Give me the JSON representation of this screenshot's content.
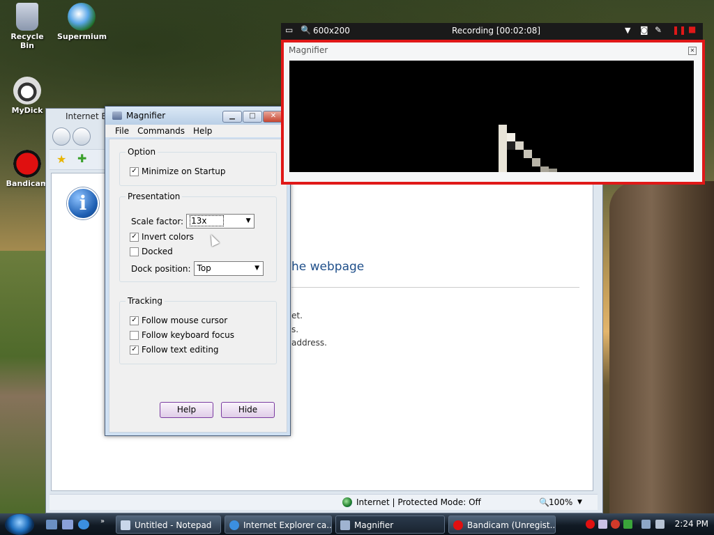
{
  "desktop": {
    "icons": [
      {
        "label": "Recycle Bin"
      },
      {
        "label": "Supermium"
      },
      {
        "label": "MyDick"
      },
      {
        "label": "Bandicam"
      }
    ]
  },
  "recorder": {
    "size_label": "600x200",
    "status": "Recording [00:02:08]"
  },
  "magnifier_view": {
    "title": "Magnifier"
  },
  "ie_window": {
    "title": "Internet Ex",
    "heading_fragment": "he webpage",
    "lines": [
      "et.",
      "s.",
      "address."
    ],
    "status_text": "Internet | Protected Mode: Off",
    "zoom": "100%"
  },
  "magnifier_dialog": {
    "title": "Magnifier",
    "menu": [
      "File",
      "Commands",
      "Help"
    ],
    "option_group": "Option",
    "minimize_on_startup": {
      "label": "Minimize on Startup",
      "checked": true
    },
    "presentation_group": "Presentation",
    "scale_label": "Scale factor:",
    "scale_value": "13x",
    "invert_colors": {
      "label": "Invert colors",
      "checked": true
    },
    "docked": {
      "label": "Docked",
      "checked": false
    },
    "dock_position_label": "Dock position:",
    "dock_position_value": "Top",
    "tracking_group": "Tracking",
    "follow_mouse": {
      "label": "Follow mouse cursor",
      "checked": true
    },
    "follow_keyboard": {
      "label": "Follow keyboard focus",
      "checked": false
    },
    "follow_text": {
      "label": "Follow text editing",
      "checked": true
    },
    "help_button": "Help",
    "hide_button": "Hide"
  },
  "taskbar": {
    "buttons": [
      {
        "label": "Untitled - Notepad"
      },
      {
        "label": "Internet Explorer ca..."
      },
      {
        "label": "Magnifier"
      },
      {
        "label": "Bandicam (Unregist..."
      }
    ],
    "clock": "2:24 PM"
  },
  "colors": {
    "record_frame": "#e01818",
    "accent": "#1e6fbf"
  }
}
